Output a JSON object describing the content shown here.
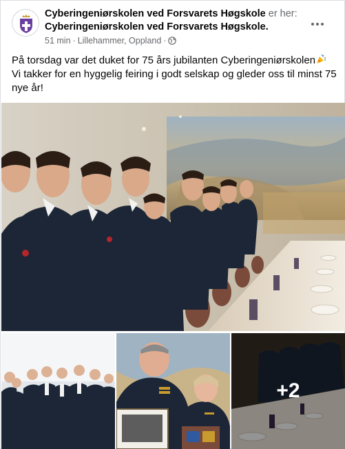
{
  "post": {
    "page_name": "Cyberingeniørskolen ved Forsvarets Høgskole",
    "shared_to_label": "er her:",
    "location_page": "Cyberingeniørskolen ved Forsvarets Høgskole",
    "location_suffix": ".",
    "time": "51 min",
    "separator": "·",
    "place": "Lillehammer, Oppland",
    "separator2": "·",
    "privacy_icon": "globe-icon",
    "text_line1": "På torsdag var det duket for 75 års jubilanten Cyberingeniørskolen",
    "text_emoji": "party-popper-icon",
    "text_line2": "Vi  takker for en hyggelig feiring i godt selskap og gleder oss til minst 75 nye år!"
  },
  "media": {
    "photo_count_overlay": "+2"
  },
  "colors": {
    "text_primary": "#050505",
    "text_secondary": "#65676b",
    "uniform_navy": "#1c2636",
    "avatar_purple": "#6b3fa0"
  }
}
